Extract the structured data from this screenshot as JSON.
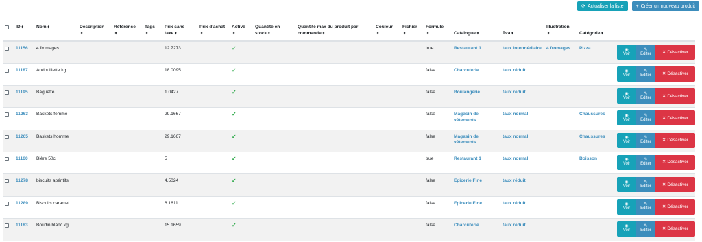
{
  "toolbar": {
    "refresh_label": "Actualiser la liste",
    "create_label": "Créer un nouveau produit"
  },
  "columns": {
    "id": "ID",
    "nom": "Nom",
    "description": "Description",
    "reference": "Référence",
    "tags": "Tags",
    "prix_sans_taxe": "Prix sans taxe",
    "prix_achat": "Prix d'achat",
    "active": "Activé",
    "quantite_stock": "Quantité en stock",
    "quantite_max": "Quantité max du produit par commande",
    "couleur": "Couleur",
    "fichier": "Fichier",
    "formule": "Formule",
    "catalogue": "Catalogue",
    "tva": "Tva",
    "illustration": "Illustration",
    "categorie": "Catégorie"
  },
  "actions": {
    "voir": "Voir",
    "editer": "Editer",
    "desactiver": "Désactiver"
  },
  "rows": [
    {
      "id": "11156",
      "nom": "4 fromages",
      "prix": "12.7273",
      "formule": "true",
      "catalogue": "Restaurant 1",
      "tva": "taux intermédiaire",
      "illustration": "4 fromages",
      "categorie": "Pizza"
    },
    {
      "id": "11187",
      "nom": "Andouillette kg",
      "prix": "18.0095",
      "formule": "false",
      "catalogue": "Charcuterie",
      "tva": "taux réduit",
      "illustration": "",
      "categorie": ""
    },
    {
      "id": "11195",
      "nom": "Baguette",
      "prix": "1.0427",
      "formule": "false",
      "catalogue": "Boulangerie",
      "tva": "taux réduit",
      "illustration": "",
      "categorie": ""
    },
    {
      "id": "11263",
      "nom": "Baskets femme",
      "prix": "29.1667",
      "formule": "false",
      "catalogue": "Magasin de vêtements",
      "tva": "taux normal",
      "illustration": "",
      "categorie": "Chaussures"
    },
    {
      "id": "11265",
      "nom": "Baskets homme",
      "prix": "29.1667",
      "formule": "false",
      "catalogue": "Magasin de vêtements",
      "tva": "taux normal",
      "illustration": "",
      "categorie": "Chaussures"
    },
    {
      "id": "11160",
      "nom": "Bière 50cl",
      "prix": "5",
      "formule": "true",
      "catalogue": "Restaurant 1",
      "tva": "taux normal",
      "illustration": "",
      "categorie": "Boisson"
    },
    {
      "id": "11278",
      "nom": "biscuits apéritifs",
      "prix": "4.5024",
      "formule": "false",
      "catalogue": "Epicerie Fine",
      "tva": "taux réduit",
      "illustration": "",
      "categorie": ""
    },
    {
      "id": "11289",
      "nom": "Biscuits caramel",
      "prix": "6.1611",
      "formule": "false",
      "catalogue": "Epicerie Fine",
      "tva": "taux réduit",
      "illustration": "",
      "categorie": ""
    },
    {
      "id": "11183",
      "nom": "Boudin blanc kg",
      "prix": "15.1659",
      "formule": "false",
      "catalogue": "Charcuterie",
      "tva": "taux réduit",
      "illustration": "",
      "categorie": ""
    }
  ]
}
